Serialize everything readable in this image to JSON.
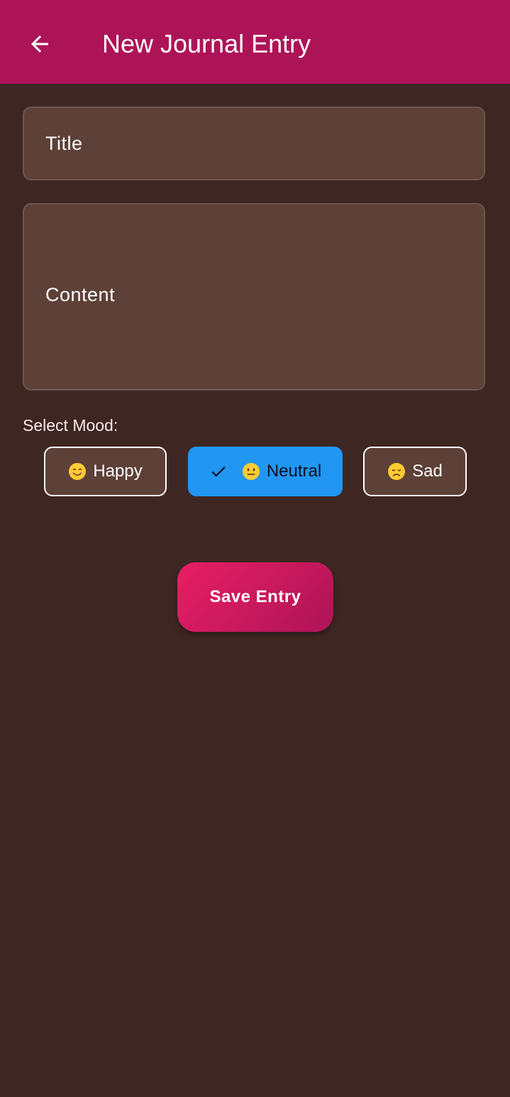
{
  "appbar": {
    "title": "New Journal Entry",
    "back_icon": "arrow-back-icon",
    "color": "#ad1457"
  },
  "form": {
    "title_placeholder": "Title",
    "title_value": "",
    "content_placeholder": "Content",
    "content_value": ""
  },
  "mood": {
    "label": "Select Mood:",
    "options": [
      {
        "emoji_icon": "smiling-face-icon",
        "label": "Happy",
        "selected": false
      },
      {
        "emoji_icon": "neutral-face-icon",
        "label": "Neutral",
        "selected": true
      },
      {
        "emoji_icon": "disappointed-face-icon",
        "label": "Sad",
        "selected": false
      }
    ],
    "selected_color": "#2196f3"
  },
  "actions": {
    "save_label": "Save Entry"
  },
  "colors": {
    "background": "#3e2723",
    "field_background": "#5d4037",
    "accent_start": "#e91e63",
    "accent_end": "#ad1457"
  }
}
